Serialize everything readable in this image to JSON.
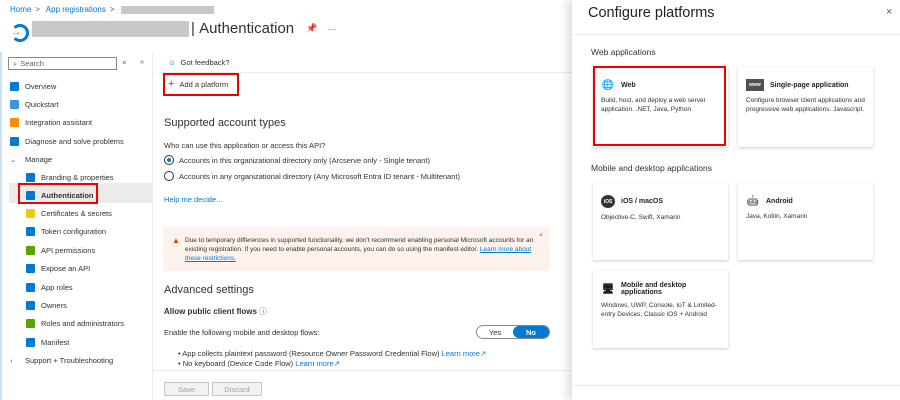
{
  "breadcrumb": {
    "home": "Home",
    "app_registrations": "App registrations"
  },
  "header": {
    "title": "Authentication",
    "pin_icon": "pin-icon",
    "more": "···"
  },
  "sidebar": {
    "search_placeholder": "Search",
    "items": [
      {
        "label": "Overview",
        "icon": "overview-icon",
        "color": "#0078d4"
      },
      {
        "label": "Quickstart",
        "icon": "quickstart-icon",
        "color": "#3a96dd"
      },
      {
        "label": "Integration assistant",
        "icon": "rocket-icon",
        "color": "#ff8c00"
      },
      {
        "label": "Diagnose and solve problems",
        "icon": "wrench-icon",
        "color": "#0078d4"
      },
      {
        "label": "Manage",
        "icon": "chevron-down-icon"
      },
      {
        "label": "Branding & properties",
        "icon": "branding-icon",
        "color": "#0078d4"
      },
      {
        "label": "Authentication",
        "icon": "authentication-icon",
        "color": "#0078d4",
        "selected": true
      },
      {
        "label": "Certificates & secrets",
        "icon": "key-icon",
        "color": "#f2c811"
      },
      {
        "label": "Token configuration",
        "icon": "token-icon",
        "color": "#0078d4"
      },
      {
        "label": "API permissions",
        "icon": "api-permissions-icon",
        "color": "#57a300"
      },
      {
        "label": "Expose an API",
        "icon": "cloud-icon",
        "color": "#0078d4"
      },
      {
        "label": "App roles",
        "icon": "app-roles-icon",
        "color": "#0078d4"
      },
      {
        "label": "Owners",
        "icon": "owners-icon",
        "color": "#0078d4"
      },
      {
        "label": "Roles and administrators",
        "icon": "roles-icon",
        "color": "#57a300"
      },
      {
        "label": "Manifest",
        "icon": "manifest-icon",
        "color": "#0078d4"
      },
      {
        "label": "Support + Troubleshooting",
        "icon": "chevron-right-icon"
      }
    ]
  },
  "main": {
    "feedback": "Got feedback?",
    "add_platform": "Add a platform",
    "supported_title": "Supported account types",
    "question": "Who can use this application or access this API?",
    "options": [
      {
        "label": "Accounts in this organizational directory only (Arcserve only - Single tenant)",
        "selected": true
      },
      {
        "label": "Accounts in any organizational directory (Any Microsoft Entra ID tenant - Multitenant)",
        "selected": false
      }
    ],
    "help": "Help me decide...",
    "warning": {
      "text": "Due to temporary differences in supported functionality, we don't recommend enabling personal Microsoft accounts for an existing registration. If you need to enable personal accounts, you can do so using the manifest editor.",
      "link": "Learn more about these restrictions."
    },
    "advanced_title": "Advanced settings",
    "public_flows": "Allow public client flows",
    "enable_label": "Enable the following mobile and desktop flows:",
    "toggle": {
      "yes": "Yes",
      "no": "No",
      "selected": "No"
    },
    "bullets": [
      {
        "text": "App collects plaintext password (Resource Owner Password Credential Flow)",
        "link": "Learn more"
      },
      {
        "text": "No keyboard (Device Code Flow)",
        "link": "Learn more"
      }
    ],
    "save": "Save",
    "discard": "Discard"
  },
  "panel": {
    "title": "Configure platforms",
    "web_section": "Web applications",
    "mobile_section": "Mobile and desktop applications",
    "cards": [
      {
        "title": "Web",
        "desc": "Build, host, and deploy a web server application. .NET, Java, Python",
        "icon": "globe-icon"
      },
      {
        "title": "Single-page application",
        "desc": "Configure browser client applications and progressive web applications. Javascript.",
        "icon": "www-icon"
      },
      {
        "title": "iOS / macOS",
        "desc": "Objective-C, Swift, Xamarin",
        "icon": "ios-icon"
      },
      {
        "title": "Android",
        "desc": "Java, Kotlin, Xamarin",
        "icon": "android-icon"
      },
      {
        "title": "Mobile and desktop applications",
        "desc": "Windows, UWP, Console, IoT & Limited-entry Devices, Classic iOS + Android",
        "icon": "desktop-icon"
      }
    ]
  }
}
